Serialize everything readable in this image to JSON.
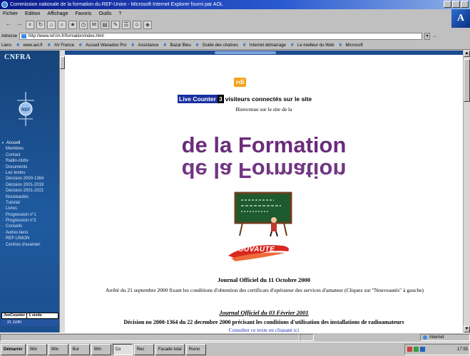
{
  "window": {
    "title": "Commission nationale de la formation du REF-Union - Microsoft Internet Explorer fourni par AOL"
  },
  "menubar": [
    "Fichier",
    "Edition",
    "Affichage",
    "Favoris",
    "Outils",
    "?"
  ],
  "address": {
    "label": "Adresse",
    "url": "http://www.ref.tm.fr/formation/index.html"
  },
  "links": {
    "label": "Liens",
    "items": [
      "www.aol.fr",
      "AV France",
      "Accueil Wanadoo Pro",
      "Assistance",
      "Bazar Bleu",
      "Guide des chaînes",
      "Internet démarrage",
      "Le meilleur du Web",
      "Microsoft"
    ]
  },
  "sidebar": {
    "title": "CNFRA",
    "nav": [
      "Accueil",
      "Membres",
      "Contact",
      "Radio-clubs",
      "Documents",
      "Les textes",
      "Décision 2000-1364",
      "Décision 2001-2019",
      "Décision 2001-2021",
      "Nouveautés",
      "Tutorial",
      "Livres",
      "Progression n°1",
      "Progression n°2",
      "Conseils",
      "Autres liens",
      "REF-UNION",
      "Centres d'examen"
    ],
    "counter_label": "JveCounter",
    "counter_value": "1 visite",
    "connected": "21 JUIN"
  },
  "main": {
    "badge": "rdi",
    "live_counter_label": "Live Counter",
    "live_counter_value": "3",
    "live_counter_text": "visiteurs connectés sur le site",
    "welcome": "Bienvenue sur le site de la",
    "big_title": "de la Formation",
    "nouveau_label": "NOUVAUTE",
    "jo1_title": "Journal Officiel du 11 Octobre 2000",
    "jo1_text": "Arrêté du 21 septembre 2000 fixant les conditions d'obtention des certificats d'opérateur des services d'amateur (Cliquez sur \"Nouveautés\" à gauche)",
    "jo2_title": "Journal Officiel du 03 Février 2001",
    "jo2_text": "Décision no 2000-1364 du 22 decembre 2000 précisant les conditions d'utilisation des installations de radioamateurs",
    "jo2_link": "Consulter ce texte en cliquant ici"
  },
  "status": {
    "zone": "Internet"
  },
  "taskbar": {
    "start": "Démarrer",
    "tasks": [
      "",
      "",
      "",
      "Win",
      "Win",
      "Bur",
      "Win",
      "Co",
      "Rec",
      "Facade total",
      "Rsmn"
    ],
    "clock": "17:55"
  }
}
